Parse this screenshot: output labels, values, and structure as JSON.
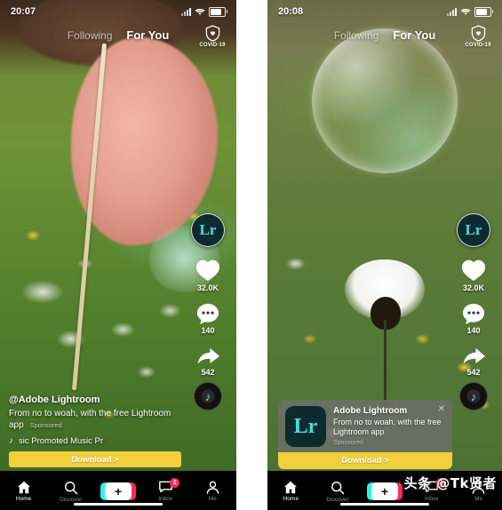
{
  "app": {
    "name": "TikTok",
    "accent_pink": "#fe2c55",
    "accent_cyan": "#26f4ee",
    "cta_yellow": "#f2cf3b",
    "brand_dark": "#0d2b2e",
    "brand_teal": "#3ee0e0"
  },
  "watermark": "头条 @Tk贤者",
  "phones": [
    {
      "id": "left",
      "status": {
        "time": "20:07",
        "signal_icon": "signal-bars-icon",
        "wifi_icon": "wifi-icon",
        "battery_icon": "battery-icon"
      },
      "top_tabs": {
        "following": "Following",
        "for_you": "For You",
        "active": "For You"
      },
      "covid": {
        "label": "COVID-19",
        "icon": "shield-heart-icon"
      },
      "rail": {
        "avatar_text": "Lr",
        "like": {
          "icon": "heart-icon",
          "count": "32.0K"
        },
        "comment": {
          "icon": "comment-icon",
          "count": "140"
        },
        "share": {
          "icon": "share-arrow-icon",
          "count": "542"
        },
        "music_disc": {
          "icon": "music-note-icon"
        }
      },
      "caption": {
        "username": "@Adobe Lightroom",
        "description": "From no to woah, with the free Lightroom app",
        "sponsored": "Sponsored",
        "music_icon": "music-note-icon",
        "music_text": "sic   Promoted Music   Pr"
      },
      "download_button": "Download >",
      "video_alt": "hand holding a white straw over grass with daisies"
    },
    {
      "id": "right",
      "status": {
        "time": "20:08",
        "signal_icon": "signal-bars-icon",
        "wifi_icon": "wifi-icon",
        "battery_icon": "battery-icon"
      },
      "top_tabs": {
        "following": "Following",
        "for_you": "For You",
        "active": "For You"
      },
      "covid": {
        "label": "COVID-19",
        "icon": "shield-heart-icon"
      },
      "rail": {
        "avatar_text": "Lr",
        "like": {
          "icon": "heart-icon",
          "count": "32.0K"
        },
        "comment": {
          "icon": "comment-icon",
          "count": "140"
        },
        "share": {
          "icon": "share-arrow-icon",
          "count": "542"
        },
        "music_disc": {
          "icon": "music-note-icon"
        }
      },
      "install_card": {
        "icon_text": "Lr",
        "title": "Adobe Lightroom",
        "description": "From no to woah, with the free Lightroom app",
        "sponsored": "Sponsored",
        "close_icon": "close-icon",
        "button": "Download >"
      },
      "video_alt": "soap bubble resting on a daisy flower"
    }
  ],
  "bottom_nav": [
    {
      "label": "Home",
      "icon": "home-icon",
      "active": true,
      "badge": ""
    },
    {
      "label": "Discover",
      "icon": "search-icon",
      "active": false,
      "badge": ""
    },
    {
      "label": "",
      "icon": "plus-create-icon",
      "active": false,
      "badge": ""
    },
    {
      "label": "Inbox",
      "icon": "message-icon",
      "active": false,
      "badge": "2"
    },
    {
      "label": "Me",
      "icon": "person-icon",
      "active": false,
      "badge": ""
    }
  ]
}
